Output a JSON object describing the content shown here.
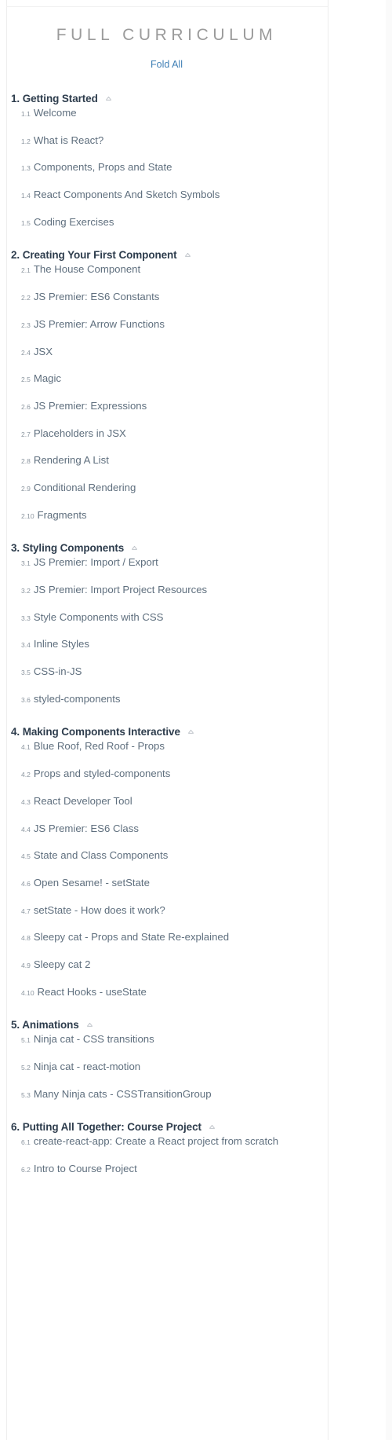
{
  "page": {
    "title": "FULL CURRICULUM",
    "fold_all_label": "Fold All",
    "colors": {
      "title": "#9b9b9b",
      "link": "#3f7fb5",
      "section_heading": "#2e3d4d",
      "lesson_text": "#5f6f7e",
      "lesson_number": "#8a949e",
      "background": "#ffffff"
    },
    "caret_icon": "chevron-up-icon"
  },
  "sections": [
    {
      "number": "1.",
      "title": "1. Getting Started",
      "collapse_state": "expanded",
      "lessons": [
        {
          "num": "1.1",
          "title": "Welcome"
        },
        {
          "num": "1.2",
          "title": "What is React?"
        },
        {
          "num": "1.3",
          "title": "Components, Props and State"
        },
        {
          "num": "1.4",
          "title": "React Components And Sketch Symbols"
        },
        {
          "num": "1.5",
          "title": "Coding Exercises"
        }
      ]
    },
    {
      "number": "2.",
      "title": "2. Creating Your First Component",
      "collapse_state": "expanded",
      "lessons": [
        {
          "num": "2.1",
          "title": "The House Component"
        },
        {
          "num": "2.2",
          "title": "JS Premier: ES6 Constants"
        },
        {
          "num": "2.3",
          "title": "JS Premier: Arrow Functions"
        },
        {
          "num": "2.4",
          "title": "JSX"
        },
        {
          "num": "2.5",
          "title": "Magic"
        },
        {
          "num": "2.6",
          "title": "JS Premier: Expressions"
        },
        {
          "num": "2.7",
          "title": "Placeholders in JSX"
        },
        {
          "num": "2.8",
          "title": "Rendering A List"
        },
        {
          "num": "2.9",
          "title": "Conditional Rendering"
        },
        {
          "num": "2.10",
          "title": "Fragments"
        }
      ]
    },
    {
      "number": "3.",
      "title": "3. Styling Components",
      "collapse_state": "expanded",
      "lessons": [
        {
          "num": "3.1",
          "title": "JS Premier: Import / Export"
        },
        {
          "num": "3.2",
          "title": "JS Premier: Import Project Resources"
        },
        {
          "num": "3.3",
          "title": "Style Components with CSS"
        },
        {
          "num": "3.4",
          "title": "Inline Styles"
        },
        {
          "num": "3.5",
          "title": "CSS-in-JS"
        },
        {
          "num": "3.6",
          "title": "styled-components"
        }
      ]
    },
    {
      "number": "4.",
      "title": "4. Making Components Interactive",
      "collapse_state": "expanded",
      "lessons": [
        {
          "num": "4.1",
          "title": "Blue Roof, Red Roof - Props"
        },
        {
          "num": "4.2",
          "title": "Props and styled-components"
        },
        {
          "num": "4.3",
          "title": "React Developer Tool"
        },
        {
          "num": "4.4",
          "title": "JS Premier: ES6 Class"
        },
        {
          "num": "4.5",
          "title": "State and Class Components"
        },
        {
          "num": "4.6",
          "title": "Open Sesame! - setState"
        },
        {
          "num": "4.7",
          "title": "setState - How does it work?"
        },
        {
          "num": "4.8",
          "title": "Sleepy cat - Props and State Re-explained"
        },
        {
          "num": "4.9",
          "title": "Sleepy cat 2"
        },
        {
          "num": "4.10",
          "title": "React Hooks - useState"
        }
      ]
    },
    {
      "number": "5.",
      "title": "5. Animations",
      "collapse_state": "expanded",
      "lessons": [
        {
          "num": "5.1",
          "title": "Ninja cat - CSS transitions"
        },
        {
          "num": "5.2",
          "title": "Ninja cat - react-motion"
        },
        {
          "num": "5.3",
          "title": "Many Ninja cats - CSSTransitionGroup"
        }
      ]
    },
    {
      "number": "6.",
      "title": "6. Putting All Together: Course Project",
      "collapse_state": "expanded",
      "lessons": [
        {
          "num": "6.1",
          "title": "create-react-app: Create a React project from scratch"
        },
        {
          "num": "6.2",
          "title": "Intro to Course Project"
        }
      ]
    }
  ]
}
